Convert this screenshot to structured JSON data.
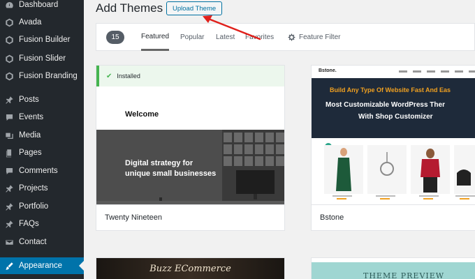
{
  "sidebar": {
    "items": [
      {
        "label": "Dashboard",
        "icon": "dashboard-icon"
      },
      {
        "label": "Avada",
        "icon": "avada-icon"
      },
      {
        "label": "Fusion Builder",
        "icon": "fusion-builder-icon"
      },
      {
        "label": "Fusion Slider",
        "icon": "fusion-slider-icon"
      },
      {
        "label": "Fusion Branding",
        "icon": "fusion-branding-icon"
      },
      {
        "label": "Posts",
        "icon": "pin-icon"
      },
      {
        "label": "Events",
        "icon": "comment-icon"
      },
      {
        "label": "Media",
        "icon": "media-icon"
      },
      {
        "label": "Pages",
        "icon": "pages-icon"
      },
      {
        "label": "Comments",
        "icon": "comment-icon"
      },
      {
        "label": "Projects",
        "icon": "pin-icon"
      },
      {
        "label": "Portfolio",
        "icon": "pin-icon"
      },
      {
        "label": "FAQs",
        "icon": "pin-icon"
      },
      {
        "label": "Contact",
        "icon": "mail-icon"
      },
      {
        "label": "Appearance",
        "icon": "brush-icon"
      }
    ]
  },
  "header": {
    "title": "Add Themes",
    "upload_label": "Upload Theme"
  },
  "filter": {
    "count": "15",
    "tabs": [
      "Featured",
      "Popular",
      "Latest",
      "Favorites"
    ],
    "feature_filter": "Feature Filter"
  },
  "themes": [
    {
      "name": "Twenty Nineteen",
      "installed_label": "Installed",
      "preview_heading": "Welcome",
      "preview_tagline_1": "Digital strategy for",
      "preview_tagline_2": "unique small businesses"
    },
    {
      "name": "Bstone",
      "logo": "Bstone.",
      "banner_1": "Build Any Type Of Website Fast And Eas",
      "banner_2": "Most Customizable WordPress Ther",
      "banner_3": "With Shop Customizer"
    },
    {
      "name": "",
      "preview_title": "Buzz ECommerce"
    },
    {
      "name": "",
      "preview_title": "THEME PREVIEW"
    }
  ],
  "colors": {
    "sidebar_bg": "#23282d",
    "active_bg": "#0073aa",
    "installed_green": "#46b450",
    "arrow_red": "#e0201b",
    "bstone_banner": "#1e2a3a",
    "bstone_orange": "#f0a020"
  }
}
